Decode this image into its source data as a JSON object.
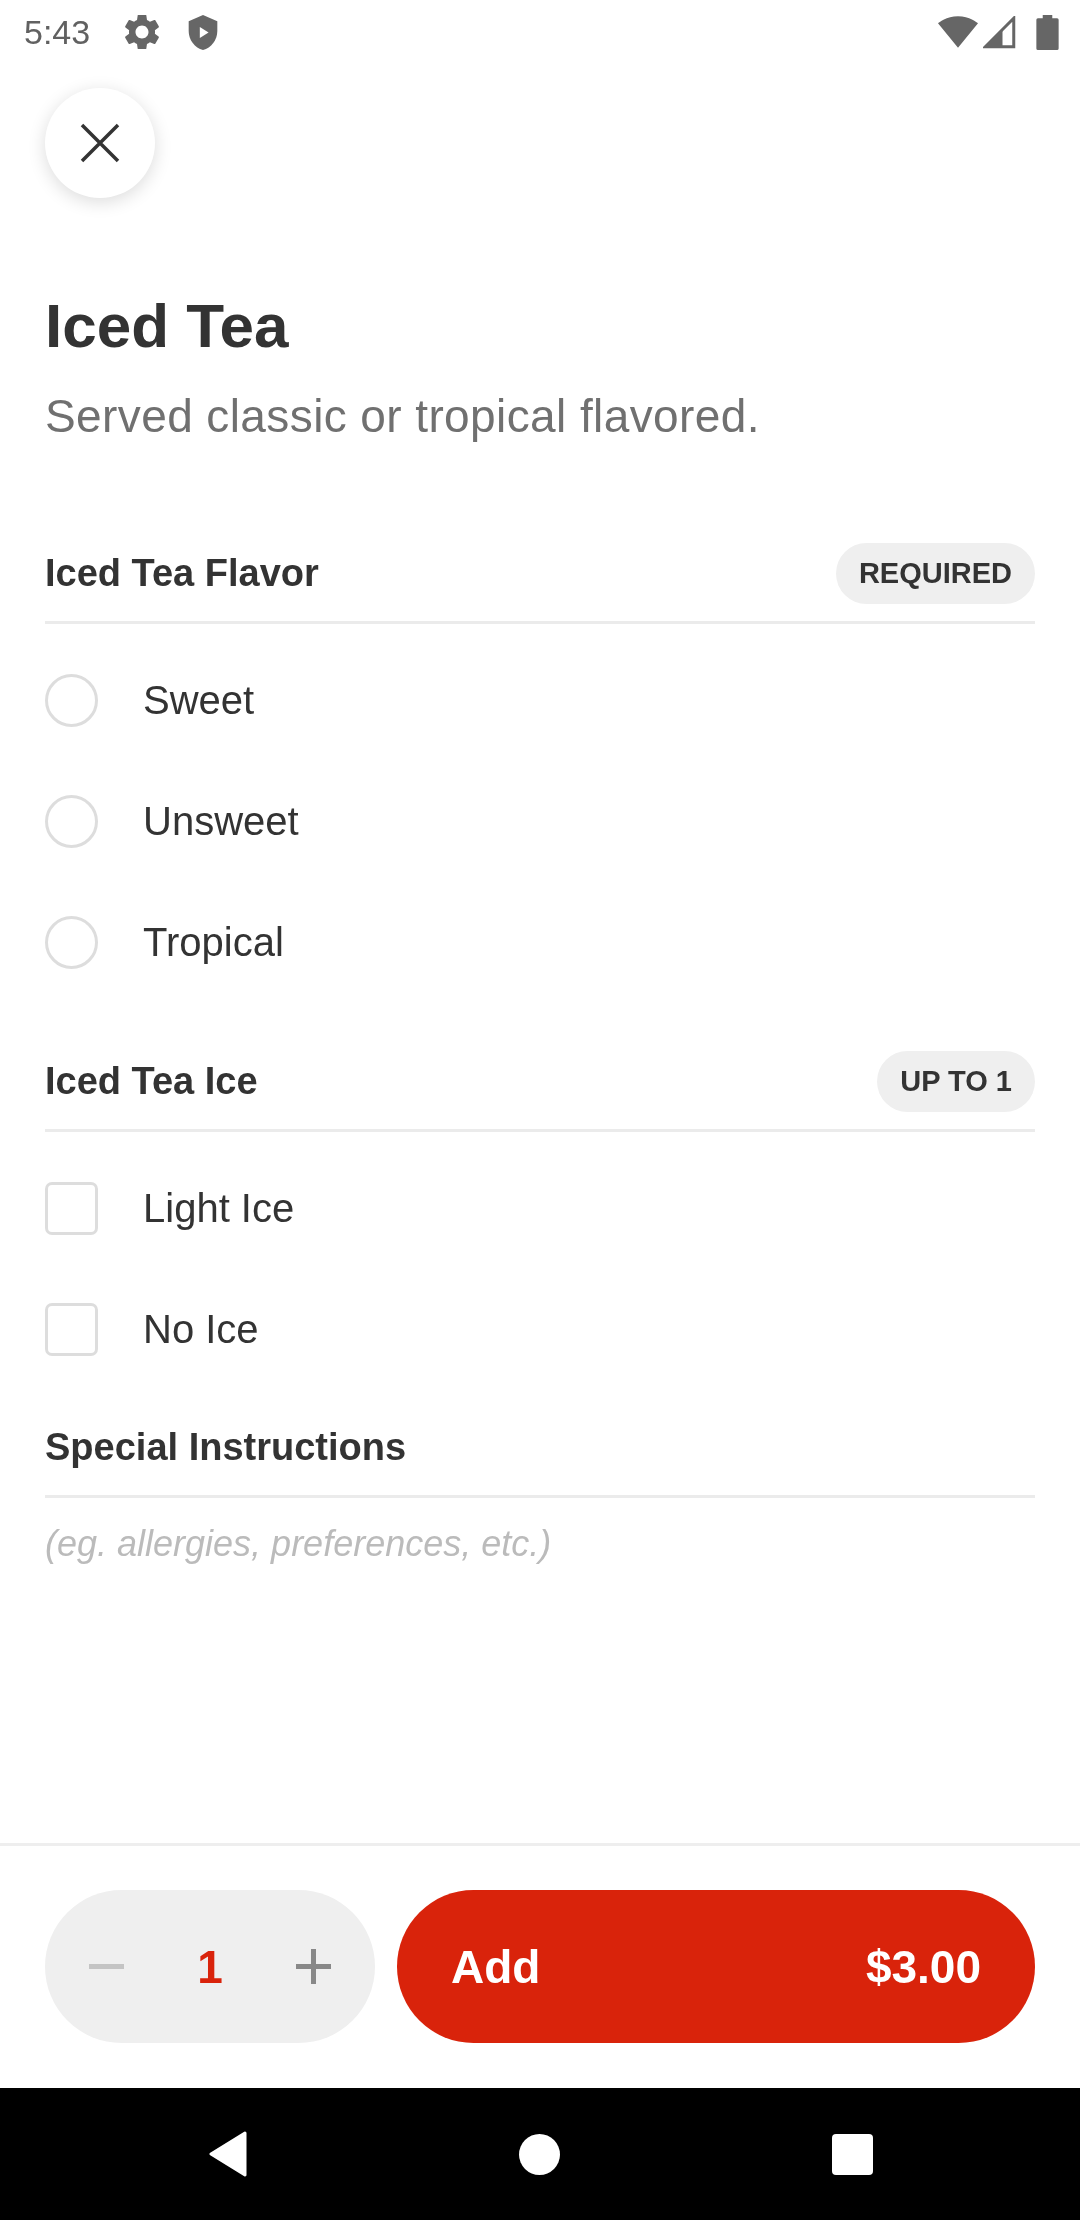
{
  "status_bar": {
    "time": "5:43"
  },
  "item": {
    "title": "Iced Tea",
    "description": "Served classic or tropical flavored."
  },
  "option_groups": [
    {
      "title": "Iced Tea Flavor",
      "badge": "REQUIRED",
      "kind": "radio",
      "options": [
        {
          "label": "Sweet",
          "selected": false
        },
        {
          "label": "Unsweet",
          "selected": false
        },
        {
          "label": "Tropical",
          "selected": false
        }
      ]
    },
    {
      "title": "Iced Tea Ice",
      "badge": "UP TO 1",
      "kind": "checkbox",
      "options": [
        {
          "label": "Light Ice",
          "checked": false
        },
        {
          "label": "No Ice",
          "checked": false
        }
      ]
    }
  ],
  "special_instructions": {
    "title": "Special Instructions",
    "placeholder": "(eg. allergies, preferences, etc.)"
  },
  "footer": {
    "stepper": {
      "decrement": {
        "disabled": true
      },
      "quantity": "1",
      "increment": {
        "disabled": false
      }
    },
    "add_button": {
      "label": "Add",
      "price": "$3.00"
    }
  }
}
